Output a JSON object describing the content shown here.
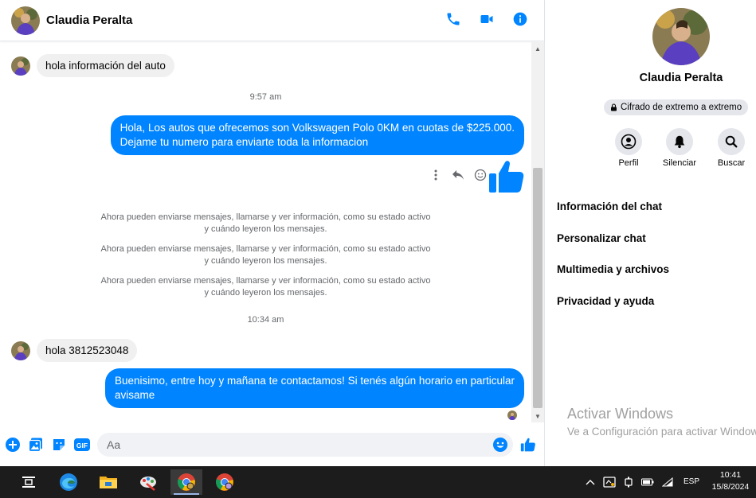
{
  "contact": {
    "name": "Claudia Peralta"
  },
  "messages": {
    "m1": "hola información del auto",
    "time1": "9:57 am",
    "m2_line1": "Hola, Los autos que ofrecemos son Volkswagen Polo 0KM en cuotas de $225.000.",
    "m2_line2": "Dejame tu numero para enviarte toda la informacion",
    "notice_line1": "Ahora pueden enviarse mensajes, llamarse y ver información, como su estado activo",
    "notice_line2": "y cuándo leyeron los mensajes.",
    "time2": "10:34 am",
    "m3": "hola 3812523048",
    "m4_line1": "Buenisimo, entre hoy y mañana te contactamos! Si tenés algún horario en particular",
    "m4_line2": "avisame"
  },
  "composer": {
    "placeholder": "Aa"
  },
  "info": {
    "name": "Claudia Peralta",
    "encryption": "Cifrado de extremo a extremo",
    "actions": {
      "profile": "Perfil",
      "mute": "Silenciar",
      "search": "Buscar"
    },
    "menu": {
      "chat_info": "Información del chat",
      "customize": "Personalizar chat",
      "media": "Multimedia y archivos",
      "privacy": "Privacidad y ayuda"
    },
    "watermark": {
      "title": "Activar Windows",
      "subtitle": "Ve a Configuración para activar Windows."
    }
  },
  "taskbar": {
    "lang": "ESP",
    "time": "10:41",
    "date": "15/8/2024"
  },
  "colors": {
    "accent": "#0084ff",
    "incoming_bubble": "#f0f0f0",
    "taskbar": "#1c1c1c"
  }
}
